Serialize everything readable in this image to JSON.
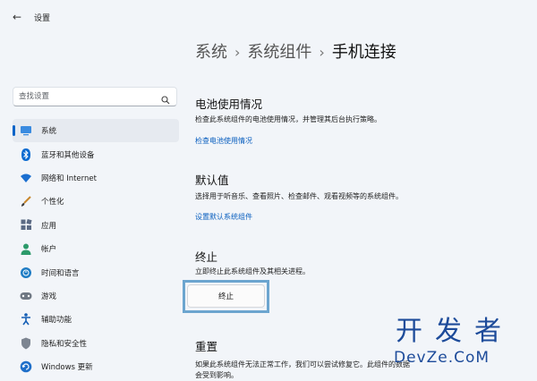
{
  "window": {
    "title": "设置"
  },
  "breadcrumb": {
    "level1": "系统",
    "level2": "系统组件",
    "current": "手机连接",
    "separator": "›"
  },
  "search": {
    "placeholder": "查找设置"
  },
  "sidebar": {
    "items": [
      {
        "label": "系统",
        "icon": "monitor-icon",
        "active": true
      },
      {
        "label": "蓝牙和其他设备",
        "icon": "bluetooth-icon"
      },
      {
        "label": "网络和 Internet",
        "icon": "wifi-icon"
      },
      {
        "label": "个性化",
        "icon": "brush-icon"
      },
      {
        "label": "应用",
        "icon": "apps-icon"
      },
      {
        "label": "帐户",
        "icon": "person-icon"
      },
      {
        "label": "时间和语言",
        "icon": "globe-clock-icon"
      },
      {
        "label": "游戏",
        "icon": "gamepad-icon"
      },
      {
        "label": "辅助功能",
        "icon": "accessibility-icon"
      },
      {
        "label": "隐私和安全性",
        "icon": "shield-icon"
      },
      {
        "label": "Windows 更新",
        "icon": "update-icon"
      }
    ]
  },
  "sections": {
    "battery": {
      "title": "电池使用情况",
      "desc": "检查此系统组件的电池使用情况，并管理其后台执行策略。",
      "link": "检查电池使用情况"
    },
    "defaults": {
      "title": "默认值",
      "desc": "选择用于听音乐、查看照片、检查邮件、观看视频等的系统组件。",
      "link": "设置默认系统组件"
    },
    "terminate": {
      "title": "终止",
      "desc": "立即终止此系统组件及其相关进程。",
      "button": "终止"
    },
    "reset": {
      "title": "重置",
      "desc1": "如果此系统组件无法正常工作，我们可以尝试修复它。此组件的数据",
      "desc2": "会受到影响。"
    }
  },
  "watermark": {
    "cn": "开发者",
    "en": "DevZe.CoM"
  },
  "colors": {
    "accent": "#0a64c8",
    "link": "#0a5fbf",
    "highlight": "#6ca5cf",
    "watermark": "#1d4b9a"
  }
}
